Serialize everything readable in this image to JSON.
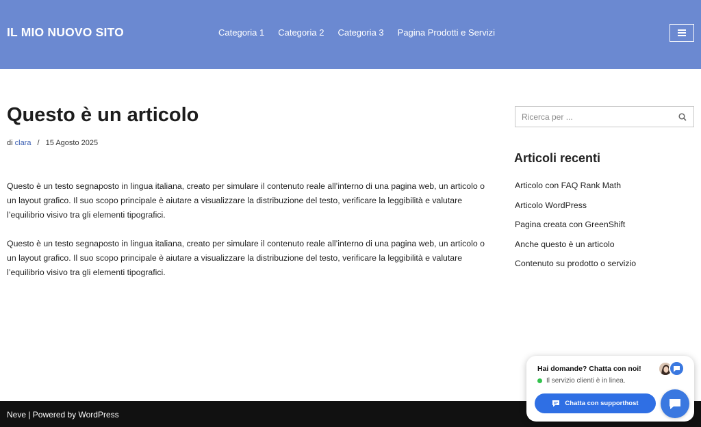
{
  "header": {
    "site_title": "IL MIO NUOVO SITO",
    "nav": [
      "Categoria 1",
      "Categoria 2",
      "Categoria 3",
      "Pagina Prodotti e Servizi"
    ],
    "menu_icon": "hamburger-icon",
    "background": "#6b89d1"
  },
  "article": {
    "title": "Questo è un articolo",
    "meta_prefix": "di",
    "author": "clara",
    "separator": "/",
    "date": "15 Agosto 2025",
    "paragraphs": [
      "Questo è un testo segnaposto in lingua italiana, creato per simulare il contenuto reale all’interno di una pagina web, un articolo o un layout grafico. Il suo scopo principale è aiutare a visualizzare la distribuzione del testo, verificare la leggibilità e valutare l’equilibrio visivo tra gli elementi tipografici.",
      "Questo è un testo segnaposto in lingua italiana, creato per simulare il contenuto reale all’interno di una pagina web, un articolo o un layout grafico. Il suo scopo principale è aiutare a visualizzare la distribuzione del testo, verificare la leggibilità e valutare l’equilibrio visivo tra gli elementi tipografici."
    ]
  },
  "sidebar": {
    "search_placeholder": "Ricerca per ...",
    "search_icon": "search-icon",
    "recent_heading": "Articoli recenti",
    "recent_posts": [
      "Articolo con FAQ Rank Math",
      "Articolo WordPress",
      "Pagina creata con GreenShift",
      "Anche questo è un articolo",
      "Contenuto su prodotto o servizio"
    ]
  },
  "footer": {
    "text": "Neve | Powered by WordPress"
  },
  "chat": {
    "title": "Hai domande? Chatta con noi!",
    "status": "Il servizio clienti è in linea.",
    "button_label": "Chatta con supporthost",
    "accent": "#2f6fe4",
    "online_color": "#33c24d"
  }
}
